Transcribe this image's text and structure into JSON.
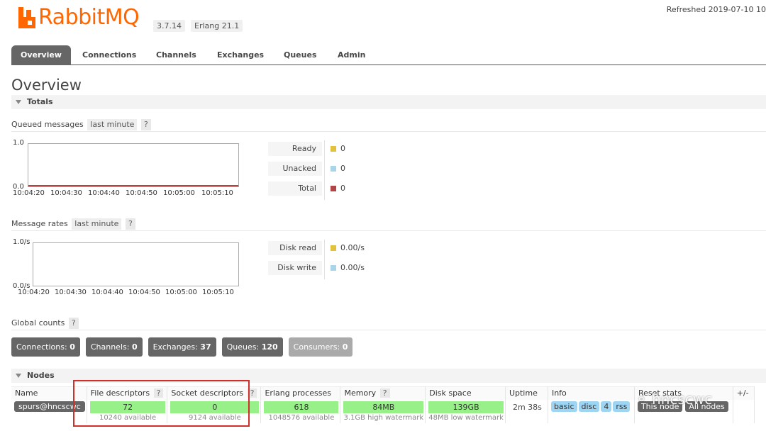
{
  "header": {
    "brand": "RabbitMQ",
    "rabbitmq_version": "3.7.14",
    "erlang_version": "Erlang 21.1",
    "refreshed": "Refreshed 2019-07-10 10"
  },
  "tabs": [
    "Overview",
    "Connections",
    "Channels",
    "Exchanges",
    "Queues",
    "Admin"
  ],
  "page_title": "Overview",
  "totals": {
    "label": "Totals",
    "queued": {
      "title": "Queued messages",
      "range": "last minute",
      "help": "?",
      "y_max": "1.0",
      "y_min": "0.0",
      "x_ticks": [
        "10:04:20",
        "10:04:30",
        "10:04:40",
        "10:04:50",
        "10:05:00",
        "10:05:10"
      ],
      "legend": [
        {
          "label": "Ready",
          "value": "0",
          "color": "#e2c23c"
        },
        {
          "label": "Unacked",
          "value": "0",
          "color": "#a9d4ea"
        },
        {
          "label": "Total",
          "value": "0",
          "color": "#b14545"
        }
      ]
    },
    "rates": {
      "title": "Message rates",
      "range": "last minute",
      "help": "?",
      "y_max": "1.0/s",
      "y_min": "0.0/s",
      "x_ticks": [
        "10:04:20",
        "10:04:30",
        "10:04:40",
        "10:04:50",
        "10:05:00",
        "10:05:10"
      ],
      "legend": [
        {
          "label": "Disk read",
          "value": "0.00/s",
          "color": "#e2c23c"
        },
        {
          "label": "Disk write",
          "value": "0.00/s",
          "color": "#a9d4ea"
        }
      ]
    },
    "global_counts": {
      "title": "Global counts",
      "help": "?",
      "items": [
        {
          "label": "Connections:",
          "value": "0"
        },
        {
          "label": "Channels:",
          "value": "0"
        },
        {
          "label": "Exchanges:",
          "value": "37"
        },
        {
          "label": "Queues:",
          "value": "120"
        },
        {
          "label": "Consumers:",
          "value": "0"
        }
      ]
    }
  },
  "nodes": {
    "label": "Nodes",
    "headers": {
      "name": "Name",
      "file_desc": "File descriptors",
      "socket_desc": "Socket descriptors",
      "erlang_proc": "Erlang processes",
      "memory": "Memory",
      "disk": "Disk space",
      "uptime": "Uptime",
      "info": "Info",
      "reset_stats": "Reset stats",
      "plusminus": "+/-",
      "help": "?"
    },
    "row": {
      "name": "spurs@hncscwc",
      "file_desc": "72",
      "file_desc_avail": "10240 available",
      "socket_desc": "0",
      "socket_desc_avail": "9124 available",
      "erlang_proc": "618",
      "erlang_proc_avail": "1048576 available",
      "memory": "84MB",
      "memory_sub": "3.1GB high watermark",
      "disk": "139GB",
      "disk_sub": "48MB low watermark",
      "uptime": "2m 38s",
      "info_tags": [
        "basic",
        "disc",
        "4",
        "rss"
      ],
      "reset_this": "This node",
      "reset_all": "All nodes"
    }
  },
  "watermark": "hncscwc"
}
